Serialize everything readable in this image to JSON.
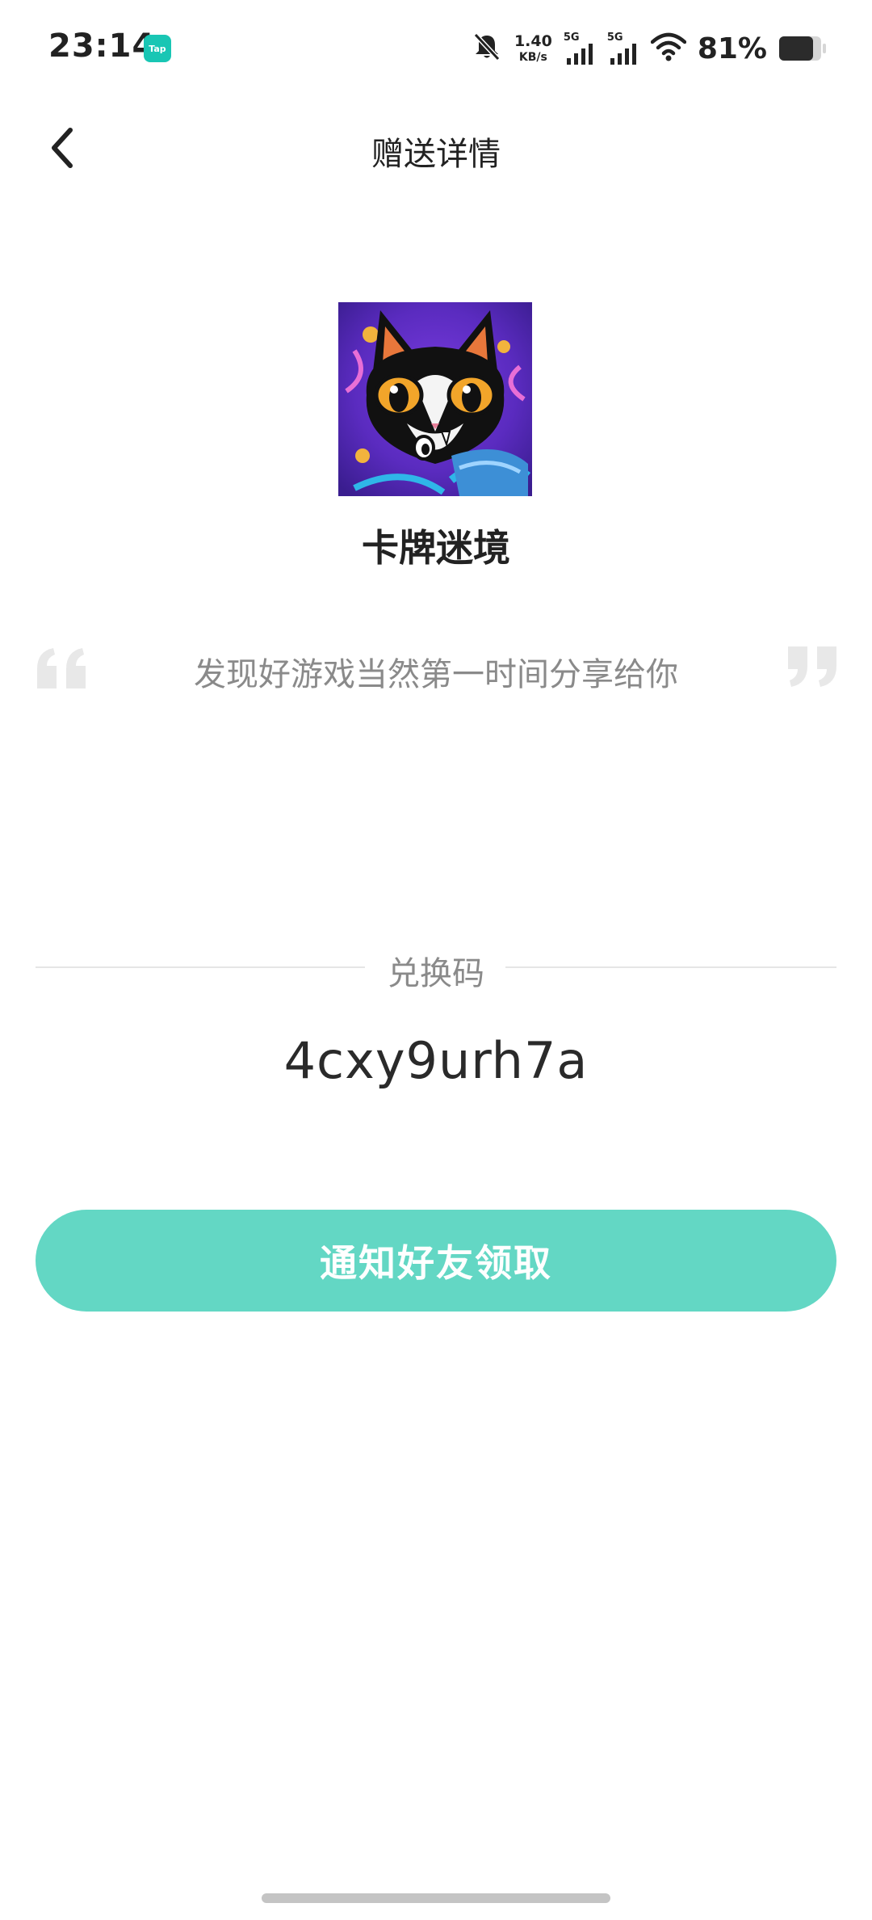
{
  "status_bar": {
    "time": "23:14",
    "app_badge": "Tap",
    "net_speed_value": "1.40",
    "net_speed_unit": "KB/s",
    "sim1_label": "5G",
    "sim2_label": "5G",
    "battery_percent": "81%",
    "battery_level": 0.81
  },
  "header": {
    "title": "赠送详情",
    "back_icon": "chevron-left-icon"
  },
  "game": {
    "name": "卡牌迷境"
  },
  "gift": {
    "message": "发现好游戏当然第一时间分享给你"
  },
  "redeem": {
    "label": "兑换码",
    "code": "4cxy9urh7a"
  },
  "actions": {
    "notify_label": "通知好友领取"
  },
  "colors": {
    "accent": "#63d7c4",
    "text_primary": "#222222",
    "text_secondary": "#8a8a8a"
  }
}
